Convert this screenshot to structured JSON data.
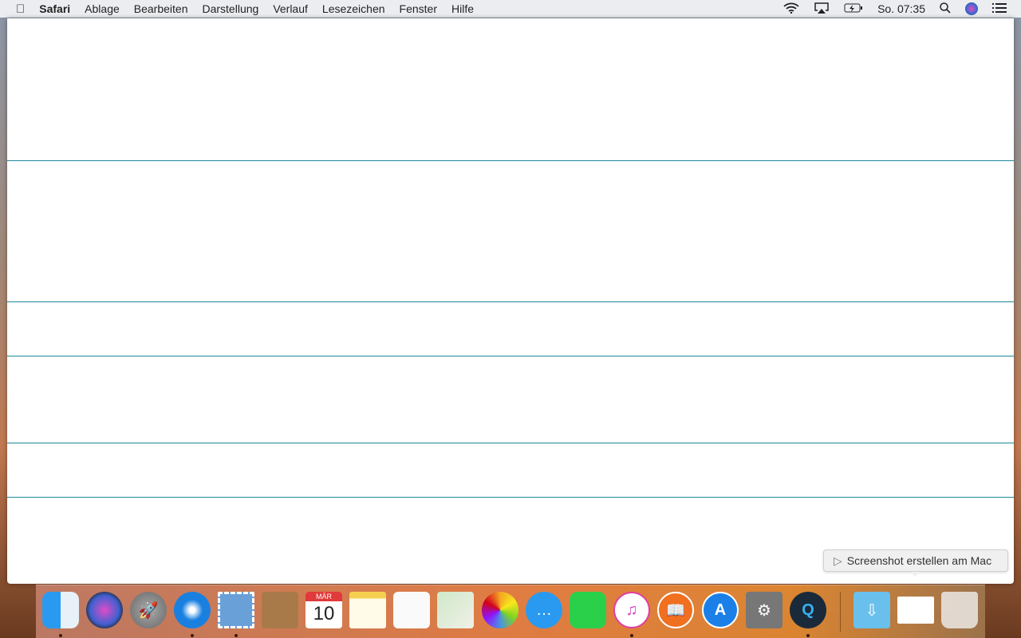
{
  "menubar": {
    "app": "Safari",
    "items": [
      "Ablage",
      "Bearbeiten",
      "Darstellung",
      "Verlauf",
      "Lesezeichen",
      "Fenster",
      "Hilfe"
    ],
    "clock": "So. 07:35"
  },
  "tooltip": {
    "label": "Screenshot erstellen am Mac"
  },
  "dock": {
    "calendar_month": "MÄR",
    "calendar_day": "10",
    "apps": [
      "finder",
      "siri",
      "launchpad",
      "safari",
      "mail",
      "contacts",
      "calendar",
      "notes",
      "reminders",
      "maps",
      "photos",
      "messages",
      "facetime",
      "itunes",
      "ibooks",
      "app-store",
      "system-preferences",
      "quicktime"
    ],
    "colors": {
      "accent": "#1a8a9a"
    }
  }
}
